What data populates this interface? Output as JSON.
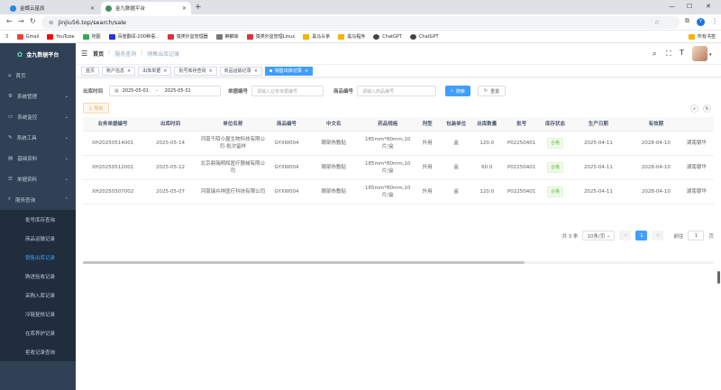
{
  "browser": {
    "tabs": [
      {
        "title": "金蝶云星辰",
        "active": false
      },
      {
        "title": "金九数据平台",
        "active": true
      }
    ],
    "new_tab": "+",
    "url": "jinjiu56.top/search/sale",
    "bookmarks": [
      "Gmail",
      "YouTube",
      "地图",
      "百度翻译-200种语...",
      "猿类外监管理器",
      "麒麟库",
      "猿类外监管理Linux",
      "黑马头条",
      "黑马程序",
      "ChatGPT",
      "ChatGPT"
    ],
    "bookmarks_all": "所有书签"
  },
  "sidebar": {
    "brand": "金九数据平台",
    "items": [
      {
        "label": "首页",
        "icon": "home-icon"
      },
      {
        "label": "系统管理",
        "icon": "gear-icon"
      },
      {
        "label": "系统监控",
        "icon": "monitor-icon"
      },
      {
        "label": "系统工具",
        "icon": "tool-icon"
      },
      {
        "label": "基础资料",
        "icon": "doc-icon"
      },
      {
        "label": "单据资料",
        "icon": "list-icon"
      },
      {
        "label": "服务查询",
        "icon": "search-icon"
      }
    ],
    "subitems": [
      "批号库存查询",
      "商品运输记录",
      "销售出库记录",
      "购进验收记录",
      "采购入库记录",
      "冷链复核记录",
      "在库养护记录",
      "拒收记录查询"
    ],
    "active_sub": "销售出库记录"
  },
  "header": {
    "breadcrumb": [
      "首页",
      "服务查询",
      "销售出库记录"
    ]
  },
  "tags": [
    "首页",
    "账户信息",
    "出库单据",
    "批号库存查询",
    "商品运输记录",
    "销售出库记录"
  ],
  "search": {
    "date_label": "出库时间",
    "date_start": "2025-05-01",
    "date_sep": "-",
    "date_end": "2025-05-31",
    "unit_label": "单据编号",
    "unit_placeholder": "请输入业务单据编号",
    "product_label": "商品编号",
    "product_placeholder": "请输入商品编号",
    "search_btn": "搜索",
    "reset_btn": "重置",
    "export_btn": "导出"
  },
  "table": {
    "headers": [
      "业务单据编号",
      "出库时间",
      "单位名称",
      "商品编号",
      "中文名",
      "药品规格",
      "剂型",
      "包装单位",
      "出库数量",
      "批号",
      "库存状态",
      "生产日期",
      "有效期",
      ""
    ],
    "rows": [
      [
        "XH20250514001",
        "2025-05-14",
        "河南千陌小屋生物科技有限公司-批次留样",
        "GYXW004",
        "眼部热敷贴",
        "185mm*80mm,10片/盒",
        "外用",
        "盒",
        "120.0",
        "P02250401",
        "合格",
        "2025-04-11",
        "2028-04-10",
        "湖南银华"
      ],
      [
        "XH20250512001",
        "2025-05-12",
        "北京鼎瑞明辉医疗器械有限公司",
        "GYXW004",
        "眼部热敷贴",
        "185mm*80mm,10片/盒",
        "外用",
        "盒",
        "60.0",
        "P02250401",
        "合格",
        "2025-04-11",
        "2028-04-10",
        "湖南银华"
      ],
      [
        "XH20250507002",
        "2025-05-07",
        "河南瑞卉祥医疗科技有限公司",
        "GYXW004",
        "眼部热敷贴",
        "185mm*80mm,10片/盒",
        "外用",
        "盒",
        "120.0",
        "P02250401",
        "合格",
        "2025-04-11",
        "2028-04-10",
        "湖南银华"
      ]
    ]
  },
  "pagination": {
    "total": "共 3 条",
    "page_size": "10条/页",
    "prev": "<",
    "current": "1",
    "next": ">",
    "goto_label": "前往",
    "goto_value": "1",
    "goto_suffix": "页"
  },
  "colors": {
    "sidebar": "#304156",
    "primary": "#409eff",
    "success": "#67c23a"
  }
}
